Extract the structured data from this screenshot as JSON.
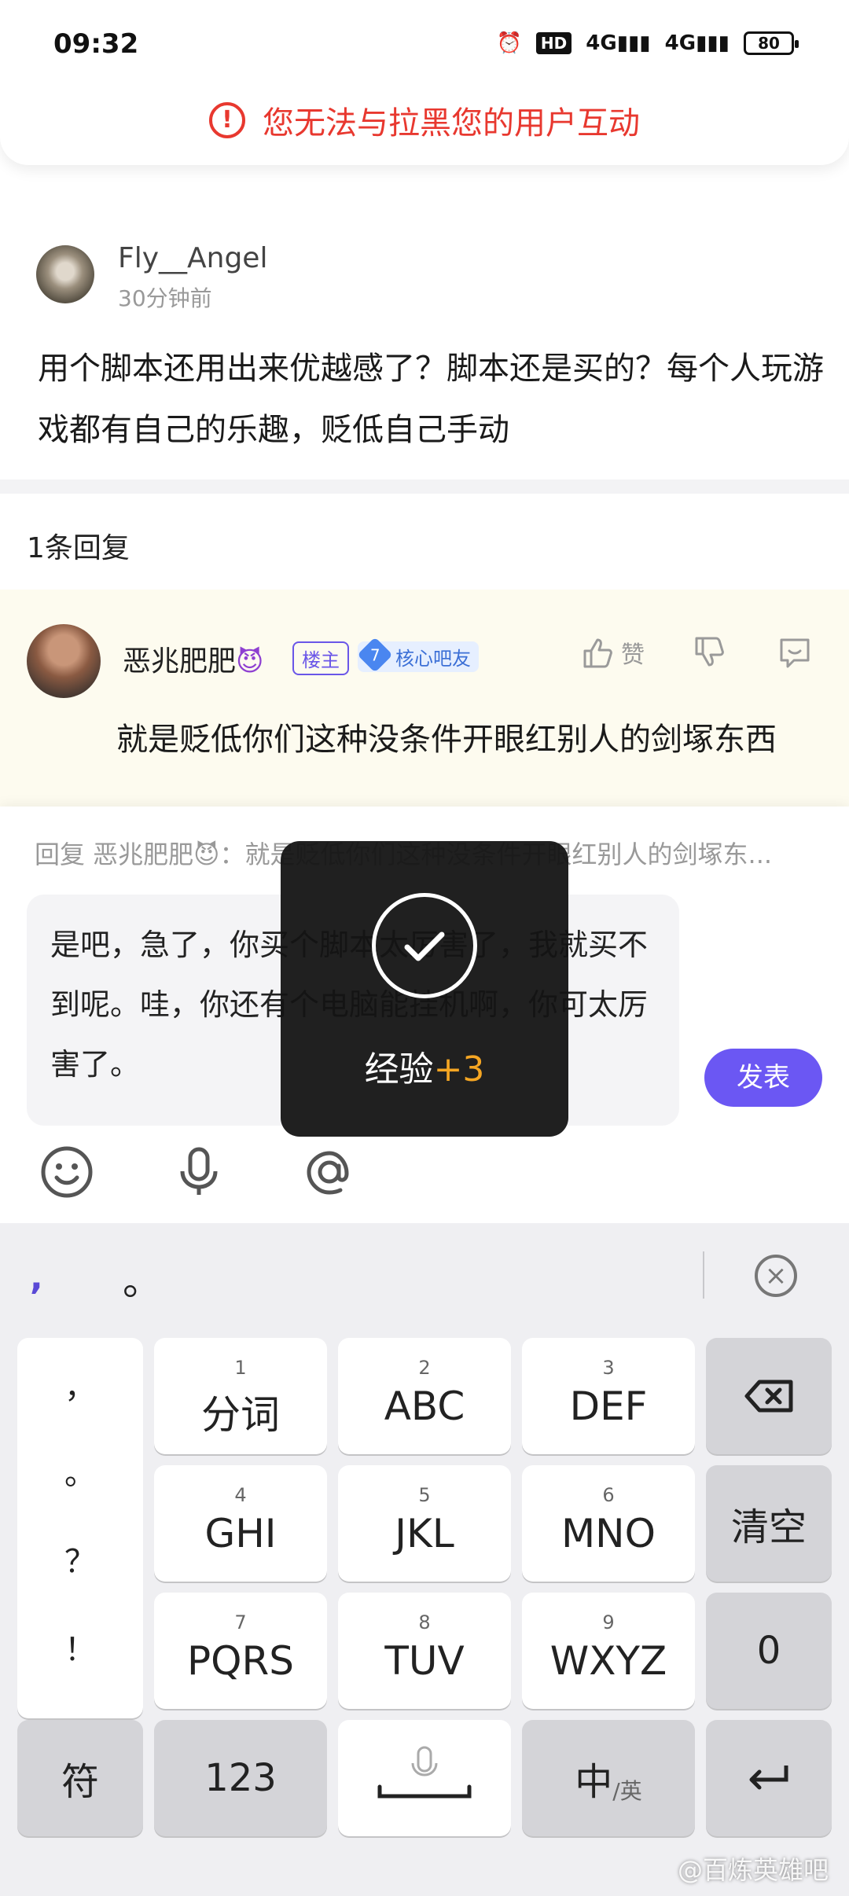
{
  "status_bar": {
    "time": "09:32",
    "hd_label": "HD",
    "net1": "4G",
    "net2": "4G",
    "battery": "80"
  },
  "warning": {
    "icon": "exclamation-circle-icon",
    "text": "您无法与拉黑您的用户互动"
  },
  "post": {
    "username": "Fly__Angel",
    "time": "30分钟前",
    "body": "用个脚本还用出来优越感了？脚本还是买的？每个人玩游戏都有自己的乐趣，贬低自己手动"
  },
  "reply_count": "1条回复",
  "reply": {
    "username": "恶兆肥肥",
    "emoji": "😈",
    "owner_tag": "楼主",
    "level": "7",
    "core_tag": "核心吧友",
    "like_label": "赞",
    "text": "就是贬低你们这种没条件开眼红别人的剑塚东西"
  },
  "composer": {
    "reply_hint": "回复 恶兆肥肥😈：就是贬低你们这种没条件开眼红别人的剑塚东...",
    "input_value": "是吧，急了，你买个脚本太厉害了，我就买不到呢。哇，你还有个电脑能挂机啊，你可太厉害了。",
    "send_label": "发表"
  },
  "toast": {
    "label": "经验",
    "bonus": "+3"
  },
  "keyboard": {
    "candidates": [
      ",",
      "。"
    ],
    "punct": [
      "，",
      "。",
      "？",
      "！"
    ],
    "keys": [
      {
        "num": "1",
        "label": "分词"
      },
      {
        "num": "2",
        "label": "ABC"
      },
      {
        "num": "3",
        "label": "DEF"
      },
      {
        "num": "4",
        "label": "GHI"
      },
      {
        "num": "5",
        "label": "JKL"
      },
      {
        "num": "6",
        "label": "MNO"
      },
      {
        "num": "7",
        "label": "PQRS"
      },
      {
        "num": "8",
        "label": "TUV"
      },
      {
        "num": "9",
        "label": "WXYZ"
      }
    ],
    "clear": "清空",
    "zero": "0",
    "symbols": "符",
    "numbers": "123",
    "lang_main": "中",
    "lang_sub": "/英"
  },
  "watermark": "@百炼英雄吧",
  "colors": {
    "accent": "#6b57f3",
    "warning": "#e8382f",
    "bonus": "#f5a623"
  }
}
